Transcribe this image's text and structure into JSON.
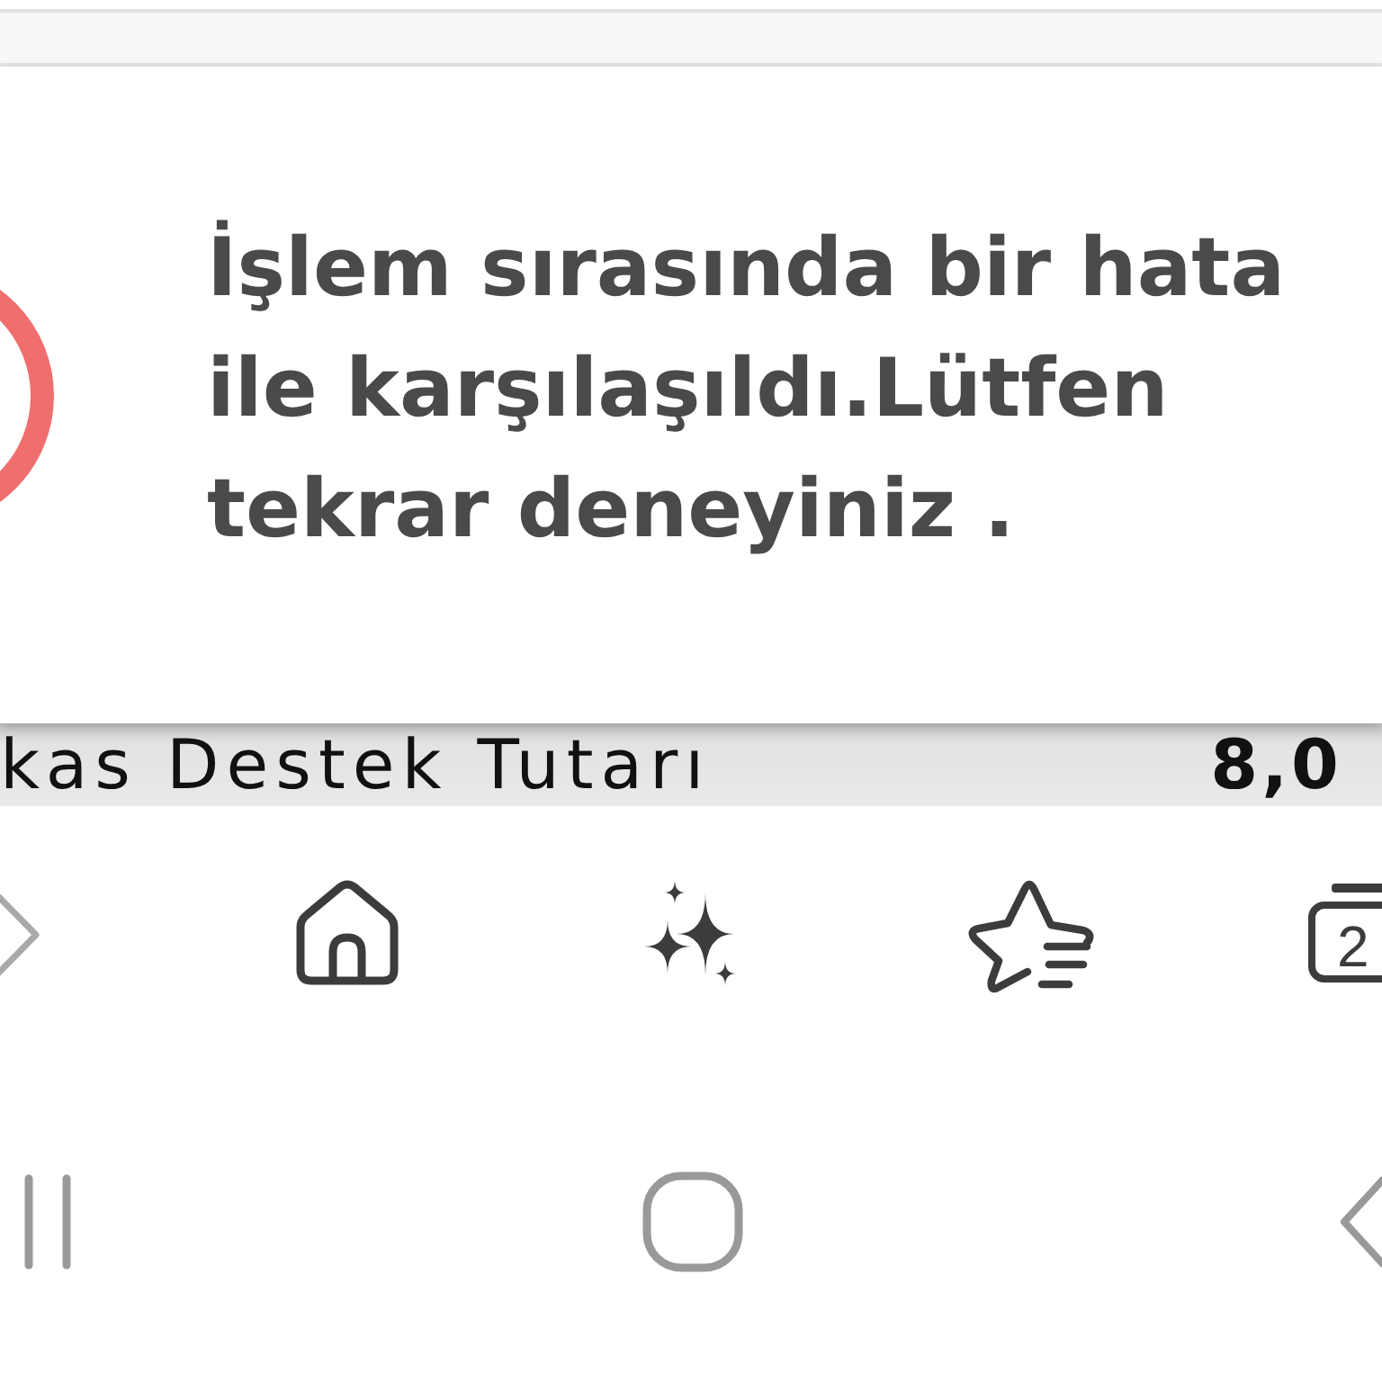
{
  "dialog": {
    "message": "İşlem sırasında bir hata ile karşılaşıldı.Lütfen tekrar deneyiniz ."
  },
  "page_behind": {
    "label": "kas Destek Tutarı",
    "amount": "8,0"
  },
  "toolbar": {
    "forward": {
      "disabled": true
    },
    "tabs": {
      "count": "2"
    }
  }
}
